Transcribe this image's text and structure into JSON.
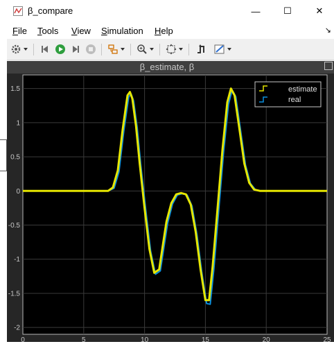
{
  "window": {
    "title": "β_compare",
    "icon": "simulink-scope-icon",
    "minimize": "—",
    "maximize": "☐",
    "close": "✕"
  },
  "menu": {
    "items": [
      {
        "label": "File",
        "mnemonic": "F"
      },
      {
        "label": "Tools",
        "mnemonic": "T"
      },
      {
        "label": "View",
        "mnemonic": "V"
      },
      {
        "label": "Simulation",
        "mnemonic": "S"
      },
      {
        "label": "Help",
        "mnemonic": "H"
      }
    ],
    "overflow": "↘"
  },
  "toolbar": {
    "icons": [
      "settings-icon",
      "step-back-icon",
      "run-icon",
      "step-forward-icon",
      "stop-icon",
      "highlight-simulink-icon",
      "zoom-in-icon",
      "autoscale-icon",
      "style-icon",
      "triggers-icon"
    ]
  },
  "colors": {
    "background": "#000000",
    "axes_bg": "#000000",
    "figure_bg": "#262626",
    "estimate": "#e6e600",
    "real": "#0a8fe0",
    "grid": "#3a3a3a",
    "ticks": "#c8c8c8"
  },
  "chart_data": {
    "type": "line",
    "title": "β_estimate, β",
    "xlabel": "",
    "ylabel": "",
    "xlim": [
      0,
      25
    ],
    "ylim": [
      -2.1,
      1.7
    ],
    "xticks": [
      0,
      5,
      10,
      15,
      20,
      25
    ],
    "yticks": [
      -2,
      -1.5,
      -1,
      -0.5,
      0,
      0.5,
      1,
      1.5
    ],
    "ytick_labels": [
      "-2",
      "-1.5",
      "-1",
      "-0.5",
      "0",
      "0.5",
      "1",
      "1.5"
    ],
    "grid": true,
    "legend": {
      "placement": "top-right",
      "entries": [
        "estimate",
        "real"
      ]
    },
    "series": [
      {
        "name": "estimate",
        "color": "#e6e600",
        "x": [
          0,
          7,
          7.4,
          7.8,
          8.2,
          8.6,
          8.8,
          9.0,
          9.3,
          9.6,
          10.0,
          10.4,
          10.8,
          11.2,
          11.5,
          11.8,
          12.2,
          12.6,
          13.0,
          13.4,
          13.8,
          14.2,
          14.6,
          15.0,
          15.3,
          15.6,
          16.0,
          16.4,
          16.8,
          17.1,
          17.4,
          17.8,
          18.2,
          18.6,
          19.0,
          19.5,
          25
        ],
        "y": [
          0,
          0,
          0.05,
          0.3,
          0.9,
          1.4,
          1.45,
          1.35,
          0.95,
          0.4,
          -0.25,
          -0.85,
          -1.2,
          -1.15,
          -0.8,
          -0.45,
          -0.18,
          -0.05,
          -0.03,
          -0.05,
          -0.2,
          -0.6,
          -1.15,
          -1.6,
          -1.6,
          -1.1,
          -0.25,
          0.6,
          1.3,
          1.5,
          1.4,
          0.9,
          0.4,
          0.12,
          0.02,
          0,
          0
        ]
      },
      {
        "name": "real",
        "color": "#0a8fe0",
        "x": [
          0,
          7,
          7.5,
          7.9,
          8.3,
          8.7,
          8.9,
          9.1,
          9.4,
          9.7,
          10.1,
          10.5,
          10.9,
          11.3,
          11.6,
          11.9,
          12.3,
          12.7,
          13.1,
          13.5,
          13.9,
          14.3,
          14.7,
          15.1,
          15.4,
          15.7,
          16.1,
          16.5,
          16.9,
          17.2,
          17.5,
          17.9,
          18.3,
          18.7,
          19.1,
          19.6,
          25
        ],
        "y": [
          0,
          0,
          0.04,
          0.28,
          0.88,
          1.38,
          1.42,
          1.32,
          0.92,
          0.37,
          -0.28,
          -0.88,
          -1.22,
          -1.17,
          -0.82,
          -0.47,
          -0.19,
          -0.06,
          -0.04,
          -0.06,
          -0.22,
          -0.63,
          -1.18,
          -1.65,
          -1.66,
          -1.14,
          -0.28,
          0.57,
          1.27,
          1.48,
          1.38,
          0.88,
          0.38,
          0.11,
          0.02,
          0,
          0
        ]
      }
    ]
  }
}
